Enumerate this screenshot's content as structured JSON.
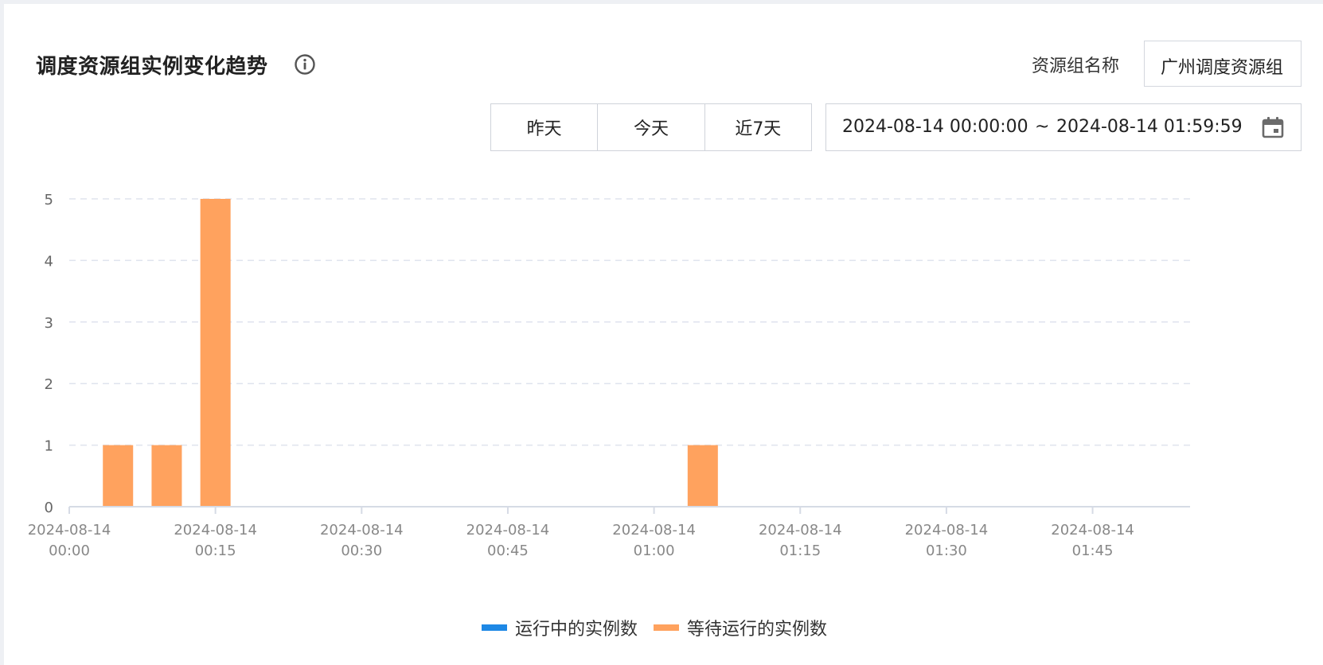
{
  "header": {
    "title": "调度资源组实例变化趋势",
    "resource_group_label": "资源组名称",
    "resource_group_value": "广州调度资源组"
  },
  "quick_range": [
    "昨天",
    "今天",
    "近7天"
  ],
  "date_range": {
    "start": "2024-08-14 00:00:00",
    "separator": "~",
    "end": "2024-08-14 01:59:59"
  },
  "colors": {
    "running": "#1e88e5",
    "waiting": "#ffa25e",
    "grid": "#dfe3ee",
    "axis": "#d6dbe5"
  },
  "legend": [
    {
      "name": "运行中的实例数",
      "color": "#1e88e5"
    },
    {
      "name": "等待运行的实例数",
      "color": "#ffa25e"
    }
  ],
  "chart_data": {
    "type": "bar",
    "x_unit": "minutes",
    "x_range": [
      0,
      115
    ],
    "ylim": [
      0,
      5
    ],
    "yticks": [
      0,
      1,
      2,
      3,
      4,
      5
    ],
    "xticks": [
      {
        "value": 0,
        "date": "2024-08-14",
        "time": "00:00"
      },
      {
        "value": 15,
        "date": "2024-08-14",
        "time": "00:15"
      },
      {
        "value": 30,
        "date": "2024-08-14",
        "time": "00:30"
      },
      {
        "value": 45,
        "date": "2024-08-14",
        "time": "00:45"
      },
      {
        "value": 60,
        "date": "2024-08-14",
        "time": "01:00"
      },
      {
        "value": 75,
        "date": "2024-08-14",
        "time": "01:15"
      },
      {
        "value": 90,
        "date": "2024-08-14",
        "time": "01:30"
      },
      {
        "value": 105,
        "date": "2024-08-14",
        "time": "01:45"
      }
    ],
    "series": [
      {
        "name": "运行中的实例数",
        "x": [],
        "values": []
      },
      {
        "name": "等待运行的实例数",
        "x": [
          5,
          10,
          15,
          65
        ],
        "values": [
          1,
          1,
          5,
          1
        ]
      }
    ]
  }
}
